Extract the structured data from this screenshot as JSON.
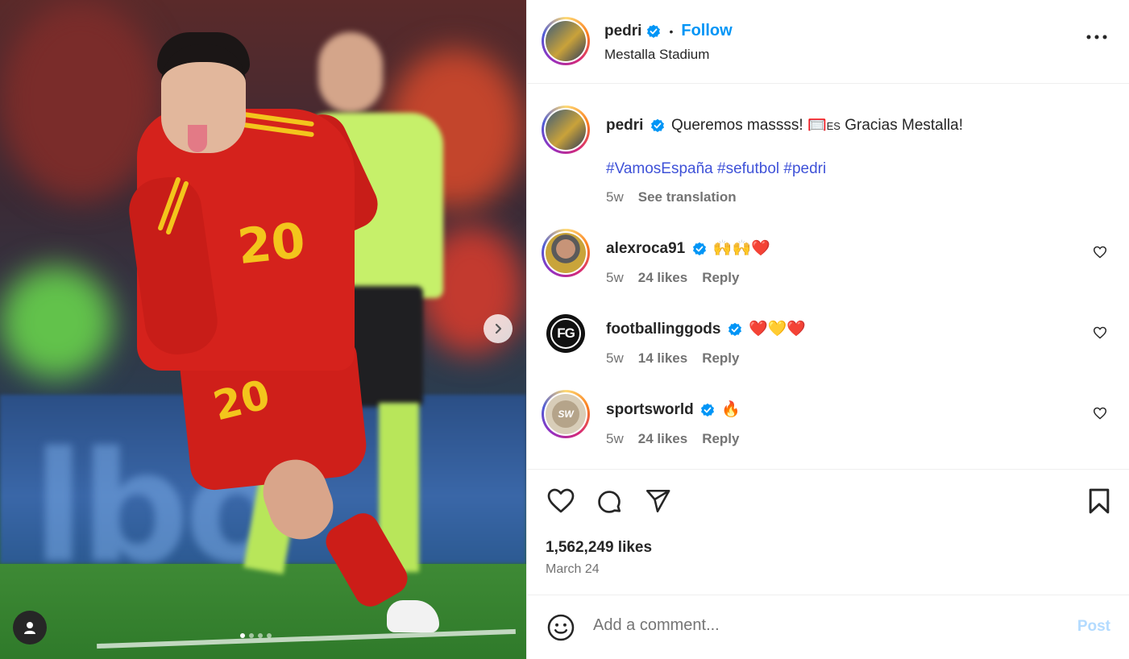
{
  "post": {
    "username": "pedri",
    "follow_label": "Follow",
    "separator": "•",
    "location": "Mestalla Stadium",
    "caption_text": "Queremos massss! ",
    "caption_emoji": "🥅",
    "caption_flag": "ES",
    "caption_rest": " Gracias Mestalla!",
    "hashtags": "#VamosEspaña #sefutbol #pedri",
    "age": "5w",
    "see_translation": "See translation",
    "likes": "1,562,249 likes",
    "date": "March 24",
    "jersey_number": "20"
  },
  "comments": [
    {
      "username": "alexroca91",
      "text": "🙌🙌❤️",
      "age": "5w",
      "likes": "24 likes",
      "reply": "Reply",
      "avatar_initials": ""
    },
    {
      "username": "footballinggods",
      "text": "❤️💛❤️",
      "age": "5w",
      "likes": "14 likes",
      "reply": "Reply",
      "avatar_initials": "FG"
    },
    {
      "username": "sportsworld",
      "text": "🔥",
      "age": "5w",
      "likes": "24 likes",
      "reply": "Reply",
      "avatar_initials": "SW"
    }
  ],
  "comment_box": {
    "placeholder": "Add a comment...",
    "post_label": "Post"
  },
  "colors": {
    "link_blue": "#0095f6",
    "hashtag": "#3f52d8",
    "verified": "#0095f6"
  },
  "carousel": {
    "slide_count": 4,
    "active_index": 0
  }
}
